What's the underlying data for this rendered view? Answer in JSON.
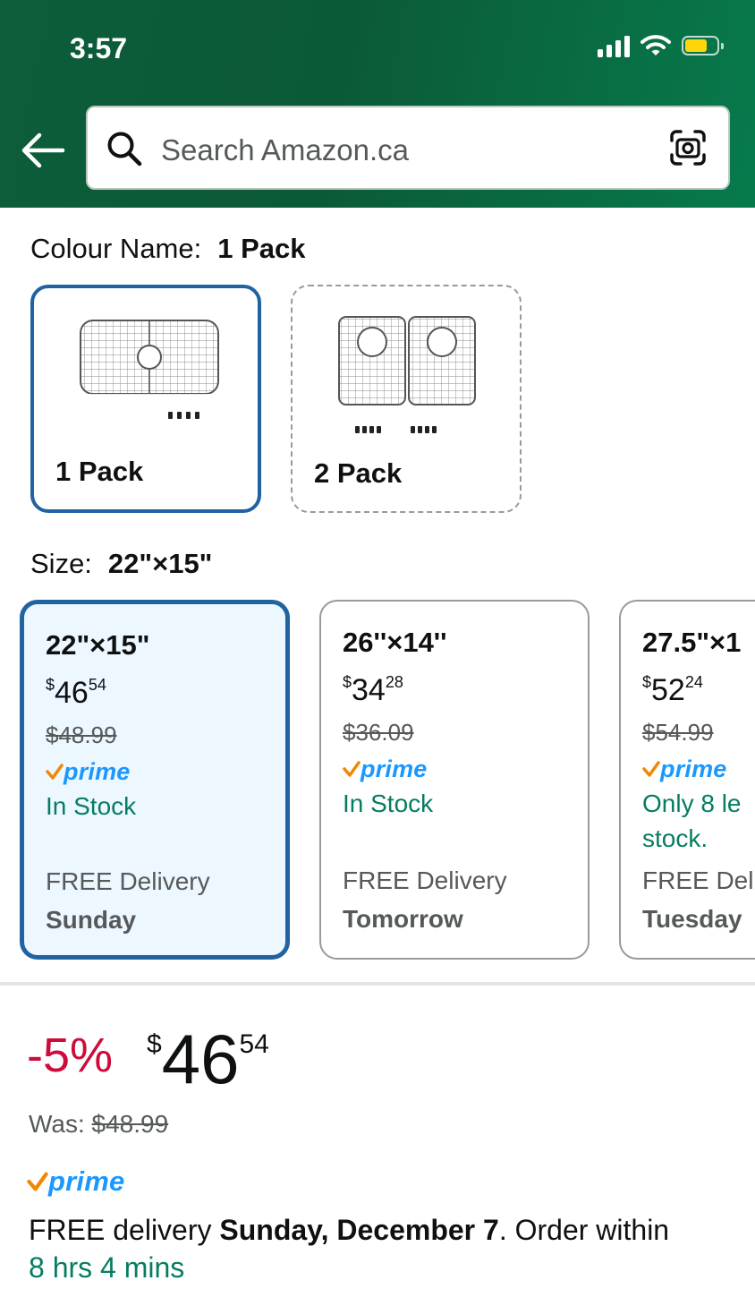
{
  "status_bar": {
    "time": "3:57"
  },
  "search": {
    "placeholder": "Search Amazon.ca"
  },
  "colour": {
    "label": "Colour Name:",
    "selected": "1 Pack",
    "options": [
      {
        "label": "1 Pack",
        "selected": true
      },
      {
        "label": "2 Pack",
        "selected": false
      }
    ]
  },
  "size": {
    "label": "Size:",
    "selected": "22\"×15\"",
    "options": [
      {
        "name": "22\"×15\"",
        "currency": "$",
        "price_whole": "46",
        "price_fraction": "54",
        "was_price": "$48.99",
        "prime": "prime",
        "stock": "In Stock",
        "delivery_label": "FREE Delivery",
        "delivery_day": "Sunday",
        "selected": true
      },
      {
        "name": "26''×14''",
        "currency": "$",
        "price_whole": "34",
        "price_fraction": "28",
        "was_price": "$36.09",
        "prime": "prime",
        "stock": "In Stock",
        "delivery_label": "FREE Delivery",
        "delivery_day": "Tomorrow",
        "selected": false
      },
      {
        "name": "27.5\"×1",
        "currency": "$",
        "price_whole": "52",
        "price_fraction": "24",
        "was_price": "$54.99",
        "prime": "prime",
        "stock_line1": "Only 8 le",
        "stock_line2": "stock.",
        "delivery_label": "FREE Deli",
        "delivery_day": "Tuesday",
        "selected": false
      }
    ]
  },
  "buy_box": {
    "discount": "-5%",
    "currency": "$",
    "price_whole": "46",
    "price_fraction": "54",
    "was_label": "Was:",
    "was_price": "$48.99",
    "prime": "prime",
    "delivery_prefix": "FREE delivery ",
    "delivery_date": "Sunday, December 7",
    "delivery_suffix": ". Order within",
    "countdown": "8 hrs 4 mins"
  },
  "colors": {
    "header_green": "#0b5a37",
    "selected_border": "#2162a1",
    "selected_bg": "#edf7ff",
    "stock_green": "#067d62",
    "discount_red": "#cc0c39",
    "prime_blue": "#1a98ff",
    "prime_check": "#f08804"
  },
  "battery_level": 0.72
}
